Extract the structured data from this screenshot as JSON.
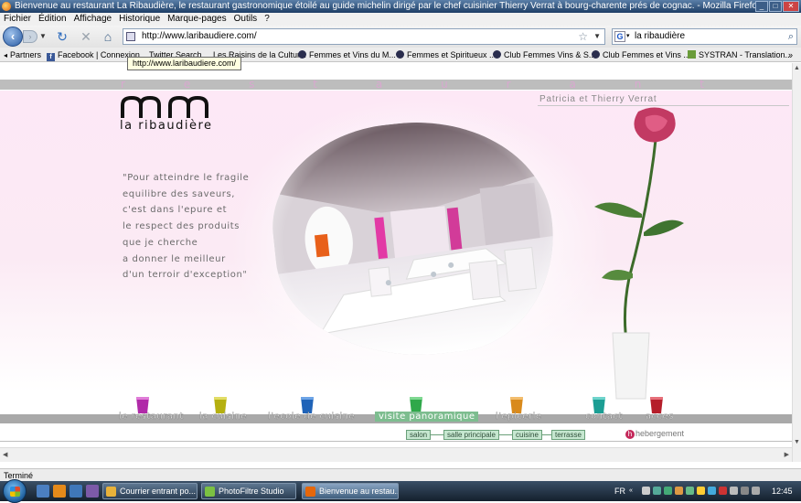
{
  "window": {
    "title": "Bienvenue au restaurant La Ribaudière, le restaurant gastronomique étoilé au guide michelin dirigé par le chef cuisinier Thierry Verrat à bourg-charente prés de cognac. - Mozilla Firefox"
  },
  "menubar": {
    "items": [
      "Fichier",
      "Édition",
      "Affichage",
      "Historique",
      "Marque-pages",
      "Outils",
      "?"
    ]
  },
  "navbar": {
    "url": "http://www.laribaudiere.com/",
    "search_value": "la ribaudière",
    "back_icon": "back-arrow-icon",
    "forward_icon": "forward-arrow-icon",
    "reload_icon": "reload-icon",
    "stop_icon": "stop-icon",
    "home_icon": "home-icon"
  },
  "bookmarks": {
    "items": [
      {
        "label": "Partners",
        "icon": "partners-icon"
      },
      {
        "label": "Facebook | Connexion",
        "icon": "facebook-icon"
      },
      {
        "label": "Twitter Search",
        "icon": "twitter-icon"
      },
      {
        "label": "Les Raisins de la Cultur...",
        "icon": "bookmark-icon"
      },
      {
        "label": "Femmes et Vins du M...",
        "icon": "bookmark-icon"
      },
      {
        "label": "Femmes et Spiritueux ...",
        "icon": "bookmark-icon"
      },
      {
        "label": "Club Femmes Vins & S...",
        "icon": "bookmark-icon"
      },
      {
        "label": "Club Femmes et Vins ...",
        "icon": "bookmark-icon"
      },
      {
        "label": "SYSTRAN - Translation...",
        "icon": "systran-icon"
      }
    ],
    "tooltip": "http://www.laribaudiere.com/"
  },
  "site": {
    "banner_letters": [
      "r",
      "e",
      "s",
      "t",
      "a",
      "u",
      "r",
      "a",
      "n",
      "t"
    ],
    "owners": "Patricia et Thierry Verrat",
    "logo_text": "la ribaudière",
    "quote_lines": [
      "\"Pour atteindre le fragile",
      "equilibre des saveurs,",
      "c'est dans l'epure et",
      "le respect des produits",
      "que je cherche",
      "a donner le meilleur",
      "d'un terroir d'exception\""
    ],
    "nav": [
      {
        "label": "le restaurant",
        "cup_color": "#b02aa8"
      },
      {
        "label": "la cuisine",
        "cup_color": "#b5b010"
      },
      {
        "label": "l'ecole de cuisine",
        "cup_color": "#1f63b8"
      },
      {
        "label": "visite panoramique",
        "cup_color": "#2fa84a"
      },
      {
        "label": "l'epicerie",
        "cup_color": "#d98a1c"
      },
      {
        "label": "contact",
        "cup_color": "#1c9e94"
      },
      {
        "label": "acces",
        "cup_color": "#b51e2a"
      }
    ],
    "active_nav": "visite panoramique",
    "subnav": [
      "salon",
      "salle principale",
      "cuisine",
      "terrasse"
    ],
    "hebergement": "hebergement",
    "hebergement_initial": "h"
  },
  "statusbar": {
    "text": "Terminé"
  },
  "taskbar": {
    "tasks": [
      {
        "label": "Courrier entrant po...",
        "icon_color": "#e8b23a"
      },
      {
        "label": "PhotoFiltre Studio",
        "icon_color": "#7bc142"
      },
      {
        "label": "Bienvenue au restau...",
        "icon_color": "#e5670b"
      }
    ],
    "lang": "FR",
    "clock": "12:45"
  }
}
